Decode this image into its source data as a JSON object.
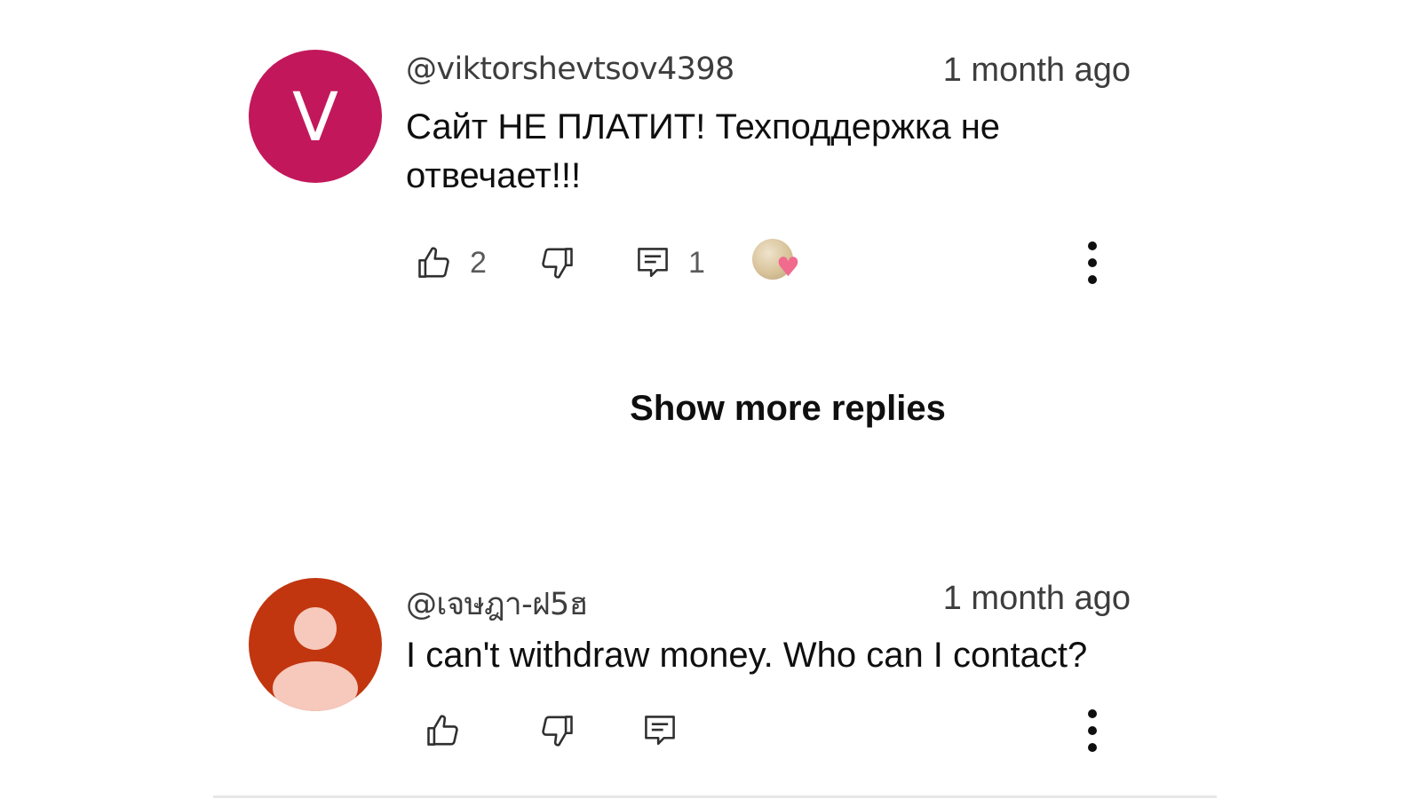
{
  "comments": [
    {
      "username": "@viktorshevtsov4398",
      "timestamp": "1 month ago",
      "text": "Сайт НЕ ПЛАТИТ! Техподдержка не отвечает!!!",
      "avatar_letter": "V",
      "avatar_color": "#c2185b",
      "likes": "2",
      "replies": "1",
      "creator_heart": true
    },
    {
      "username": "@เจษฎา-ฝ5ฮ",
      "timestamp": "1 month ago",
      "text": "I can't withdraw money. Who can I contact?",
      "avatar_icon": "person-icon",
      "avatar_color": "#c1360f"
    }
  ],
  "show_more_replies": "Show more replies"
}
